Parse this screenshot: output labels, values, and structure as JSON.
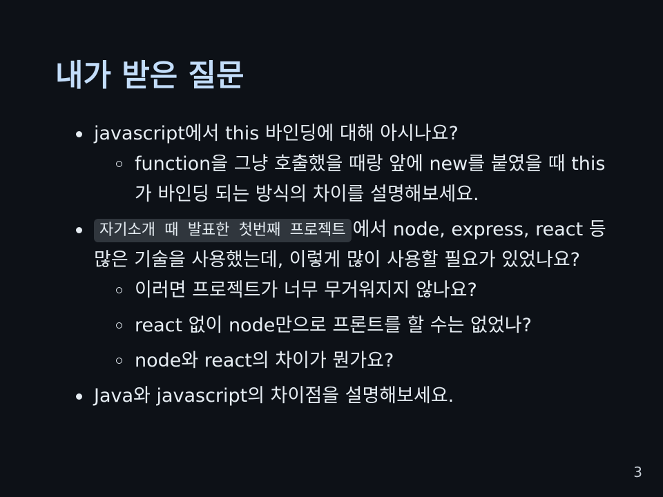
{
  "slide": {
    "title": "내가 받은 질문",
    "page_number": "3"
  },
  "questions": [
    {
      "text": "javascript에서 this 바인딩에 대해 아시나요?",
      "sub": [
        "function을 그냥 호출했을 때랑 앞에 new를 붙였을 때 this가 바인딩 되는 방식의 차이를 설명해보세요."
      ]
    },
    {
      "code": "자기소개 때 발표한 첫번째 프로젝트",
      "text": "에서 node, express, react 등 많은 기술을 사용했는데, 이렇게 많이 사용할 필요가 있었나요?",
      "sub": [
        "이러면 프로젝트가 너무 무거워지지 않나요?",
        "react 없이 node만으로 프론트를 할 수는 없었나?",
        "node와 react의 차이가 뭔가요?"
      ]
    },
    {
      "text": "Java와 javascript의 차이점을 설명해보세요.",
      "sub": []
    }
  ]
}
